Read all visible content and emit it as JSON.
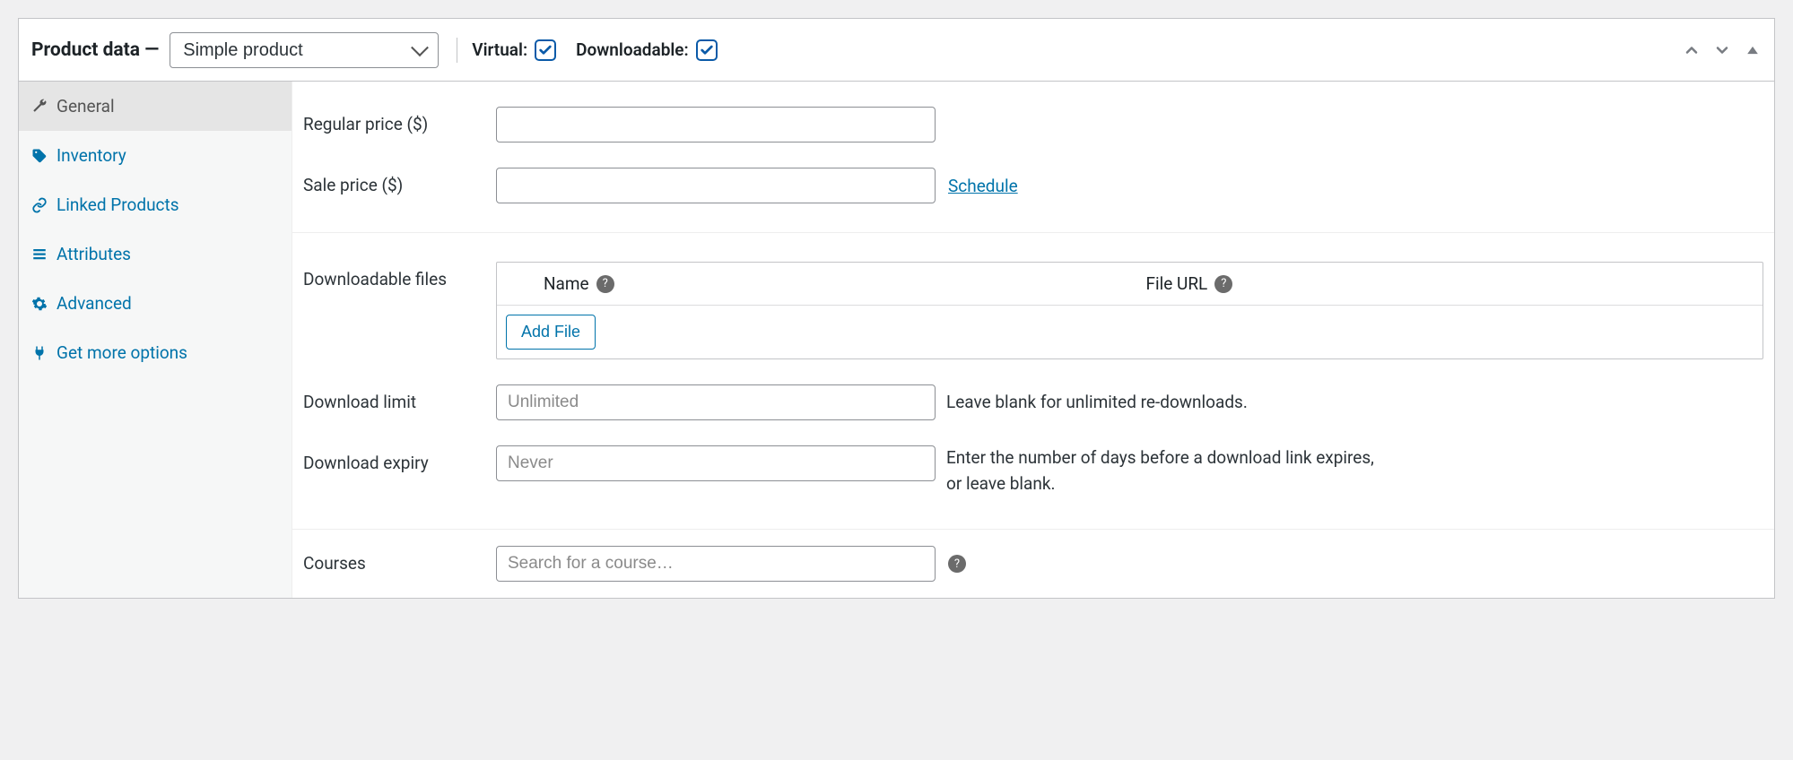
{
  "header": {
    "title": "Product data —",
    "product_type": "Simple product",
    "virtual_label": "Virtual:",
    "virtual_checked": true,
    "downloadable_label": "Downloadable:",
    "downloadable_checked": true
  },
  "sidebar": {
    "items": [
      {
        "label": "General",
        "icon": "wrench-icon",
        "active": true
      },
      {
        "label": "Inventory",
        "icon": "tag-icon",
        "active": false
      },
      {
        "label": "Linked Products",
        "icon": "link-icon",
        "active": false
      },
      {
        "label": "Attributes",
        "icon": "list-icon",
        "active": false
      },
      {
        "label": "Advanced",
        "icon": "gear-icon",
        "active": false
      },
      {
        "label": "Get more options",
        "icon": "plug-icon",
        "active": false
      }
    ]
  },
  "form": {
    "regular_price_label": "Regular price ($)",
    "sale_price_label": "Sale price ($)",
    "schedule_link": "Schedule",
    "downloadable_files_label": "Downloadable files",
    "files_table": {
      "col_name": "Name",
      "col_url": "File URL",
      "add_file_button": "Add File"
    },
    "download_limit_label": "Download limit",
    "download_limit_placeholder": "Unlimited",
    "download_limit_hint": "Leave blank for unlimited re-downloads.",
    "download_expiry_label": "Download expiry",
    "download_expiry_placeholder": "Never",
    "download_expiry_hint": "Enter the number of days before a download link expires, or leave blank.",
    "courses_label": "Courses",
    "courses_placeholder": "Search for a course…"
  }
}
